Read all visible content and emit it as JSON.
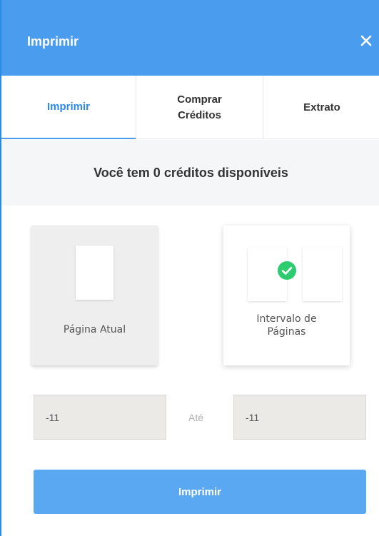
{
  "header": {
    "title": "Imprimir",
    "close_icon": "close-icon"
  },
  "tabs": [
    {
      "label": "Imprimir",
      "active": true
    },
    {
      "label": "Comprar\nCréditos",
      "active": false
    },
    {
      "label": "Extrato",
      "active": false
    }
  ],
  "credits": {
    "message": "Você tem 0 créditos disponíveis"
  },
  "options": {
    "current_page": {
      "label": "Página Atual",
      "selected": false
    },
    "page_range": {
      "label": "Intervalo de Páginas",
      "selected": true
    }
  },
  "range": {
    "from_value": "-11",
    "to_value": "-11",
    "separator": "Até"
  },
  "print_button": {
    "label": "Imprimir"
  },
  "colors": {
    "accent": "#4a9cef",
    "button": "#5aa8f1",
    "check": "#2ecc71"
  }
}
